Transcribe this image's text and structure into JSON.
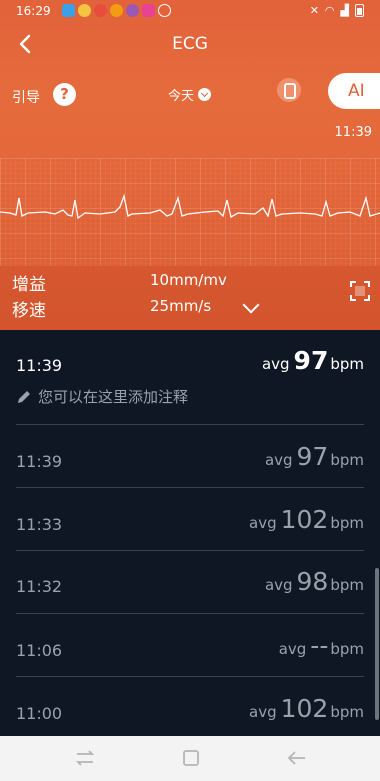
{
  "status": {
    "time": "16:29"
  },
  "header": {
    "title": "ECG"
  },
  "controls": {
    "guide_label": "引导",
    "help_symbol": "?",
    "date_label": "今天",
    "ai_label": "AI"
  },
  "ecg": {
    "record_time": "11:39"
  },
  "settings": {
    "gain_label": "增益",
    "gain_value": "10mm/mv",
    "speed_label": "移速",
    "speed_value": "25mm/s"
  },
  "records": [
    {
      "time": "11:39",
      "avg_label": "avg",
      "bpm": "97",
      "unit": "bpm",
      "note_placeholder": "您可以在这里添加注释"
    },
    {
      "time": "11:39",
      "avg_label": "avg",
      "bpm": "97",
      "unit": "bpm"
    },
    {
      "time": "11:33",
      "avg_label": "avg",
      "bpm": "102",
      "unit": "bpm"
    },
    {
      "time": "11:32",
      "avg_label": "avg",
      "bpm": "98",
      "unit": "bpm"
    },
    {
      "time": "11:06",
      "avg_label": "avg",
      "bpm": "--",
      "unit": "bpm"
    },
    {
      "time": "11:00",
      "avg_label": "avg",
      "bpm": "102",
      "unit": "bpm"
    }
  ],
  "colors": {
    "accent": "#e2623a",
    "list_bg": "#0f1724"
  }
}
